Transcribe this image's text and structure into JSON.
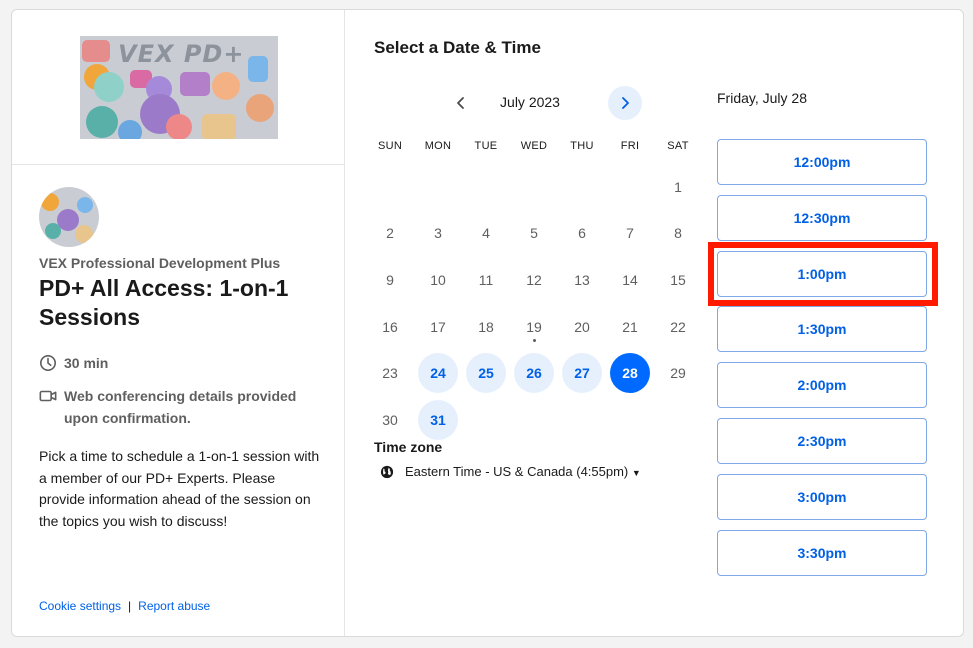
{
  "event": {
    "organization": "VEX Professional Development Plus",
    "title": "PD+ All Access: 1-on-1 Sessions",
    "duration": "30 min",
    "location": "Web conferencing details provided upon confirmation.",
    "description": "Pick a time to schedule a 1-on-1 session with a member of our PD+ Experts. Please provide information ahead of the session on the topics you wish to discuss!",
    "banner_logo": "VEX PD+"
  },
  "footer": {
    "cookie_settings": "Cookie settings",
    "separator": "|",
    "report_abuse": "Report abuse"
  },
  "calendar": {
    "heading": "Select a Date & Time",
    "month": "July 2023",
    "weekdays": [
      "SUN",
      "MON",
      "TUE",
      "WED",
      "THU",
      "FRI",
      "SAT"
    ],
    "weeks": [
      [
        null,
        null,
        null,
        null,
        null,
        null,
        "1"
      ],
      [
        "2",
        "3",
        "4",
        "5",
        "6",
        "7",
        "8"
      ],
      [
        "9",
        "10",
        "11",
        "12",
        "13",
        "14",
        "15"
      ],
      [
        "16",
        "17",
        "18",
        "19",
        "20",
        "21",
        "22"
      ],
      [
        "23",
        "24",
        "25",
        "26",
        "27",
        "28",
        "29"
      ],
      [
        "30",
        "31",
        null,
        null,
        null,
        null,
        null
      ]
    ],
    "available_days": [
      "24",
      "25",
      "26",
      "27",
      "28",
      "31"
    ],
    "selected_day": "28",
    "today_marker_day": "19",
    "accent_color": "#0069ff"
  },
  "timezone": {
    "label": "Time zone",
    "value": "Eastern Time - US & Canada (4:55pm)",
    "dropdown_icon": "caret-down-icon"
  },
  "slots": {
    "date_label": "Friday, July 28",
    "times": [
      "12:00pm",
      "12:30pm",
      "1:00pm",
      "1:30pm",
      "2:00pm",
      "2:30pm",
      "3:00pm",
      "3:30pm"
    ],
    "highlighted": "1:00pm",
    "highlight_color": "#ff1a00"
  }
}
